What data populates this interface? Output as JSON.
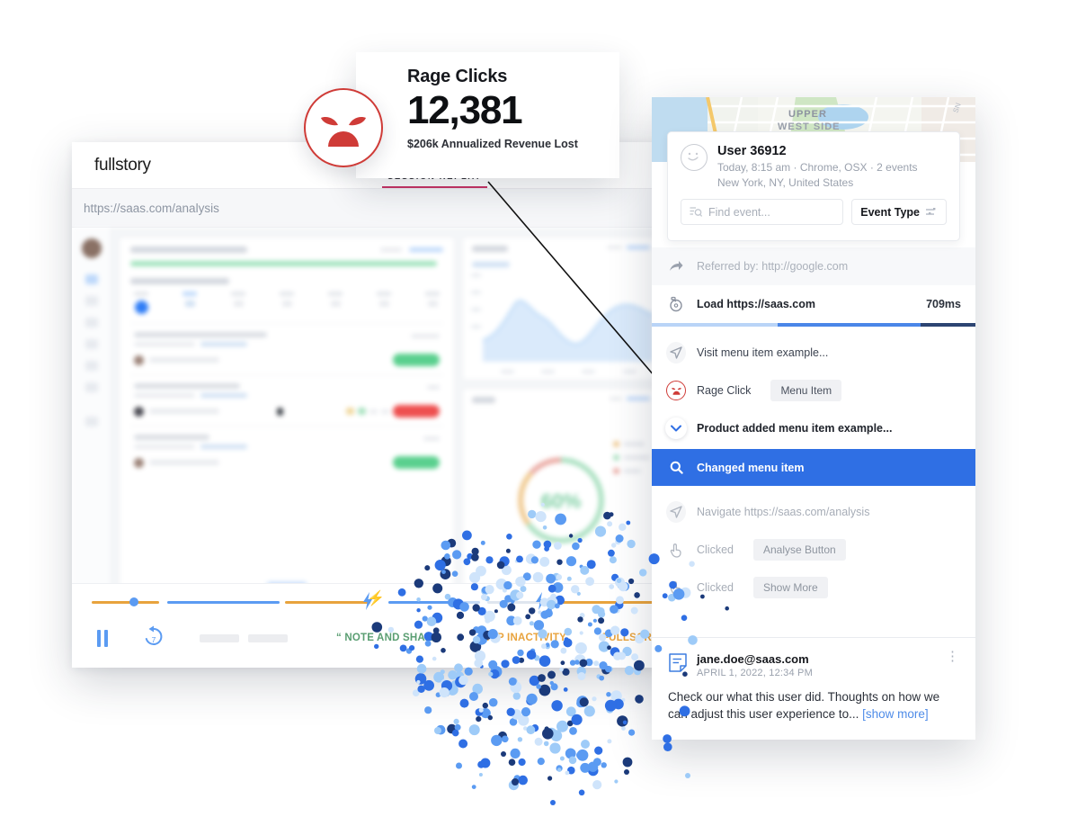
{
  "app": {
    "brand": "fullstory",
    "tab": "SESSION REPLAY",
    "url": "https://saas.com/analysis"
  },
  "callout": {
    "title": "Rage Clicks",
    "value": "12,381",
    "subtitle": "$206k Annualized Revenue Lost",
    "icon": "angry-face-icon",
    "accent": "#cf3b37"
  },
  "player": {
    "pause_label": "Pause",
    "rewind_label": "7",
    "note_and_share": "“ NOTE AND SHARE",
    "skip_inactivity": "SKIP INACTIVITY",
    "fullscreen": "FULLSCREEN",
    "timeline_colors": {
      "orange": "#e8a33d",
      "blue": "#5b9bf2"
    }
  },
  "map": {
    "label_line1": "UPPER",
    "label_line2": "WEST SIDE"
  },
  "user": {
    "name": "User 36912",
    "meta": "Today, 8:15 am · Chrome, OSX · 2 events",
    "location": "New York, NY, United States",
    "find_event_placeholder": "Find event...",
    "event_type_label": "Event Type"
  },
  "events": [
    {
      "name": "referrer",
      "icon": "share-arrow-icon",
      "label": "Referred by: http://google.com",
      "style": "muted"
    },
    {
      "name": "page-load",
      "icon": "stopwatch-icon",
      "label": "Load https://saas.com",
      "right": "709ms",
      "style": "strong",
      "loadbar": [
        {
          "color": "#b9d4f7",
          "pct": 39
        },
        {
          "color": "#4a86e8",
          "pct": 44
        },
        {
          "color": "#2c4472",
          "pct": 17
        }
      ]
    },
    {
      "name": "visit",
      "icon": "navigate-icon",
      "label": "Visit menu item example...",
      "style": "normal"
    },
    {
      "name": "rage-click",
      "icon": "angry-face-icon",
      "label": "Rage Click",
      "chip": "Menu Item",
      "style": "normal"
    },
    {
      "name": "product-added",
      "icon": "chevron-down-icon",
      "label": "Product added menu item example...",
      "style": "strong"
    },
    {
      "name": "changed-menu-item",
      "icon": "search-icon",
      "label": "Changed menu item",
      "style": "selected"
    },
    {
      "name": "navigate",
      "icon": "navigate-icon",
      "label": "Navigate https://saas.com/analysis",
      "style": "dim"
    },
    {
      "name": "clicked-analyse",
      "icon": "click-hand-icon",
      "label": "Clicked",
      "chip": "Analyse Button",
      "style": "dim"
    },
    {
      "name": "clicked-show-more",
      "icon": "click-hand-icon",
      "label": "Clicked",
      "chip": "Show More",
      "style": "dim"
    }
  ],
  "comment": {
    "icon": "note-icon",
    "author": "jane.doe@saas.com",
    "date": "APRIL 1, 2022, 12:34 PM",
    "body": "Check our what this user did. Thoughts on how we can adjust this user experience to...",
    "show_more": "[show more]",
    "kebab": "⋮"
  },
  "dashboard": {
    "donut_value": "60%"
  }
}
